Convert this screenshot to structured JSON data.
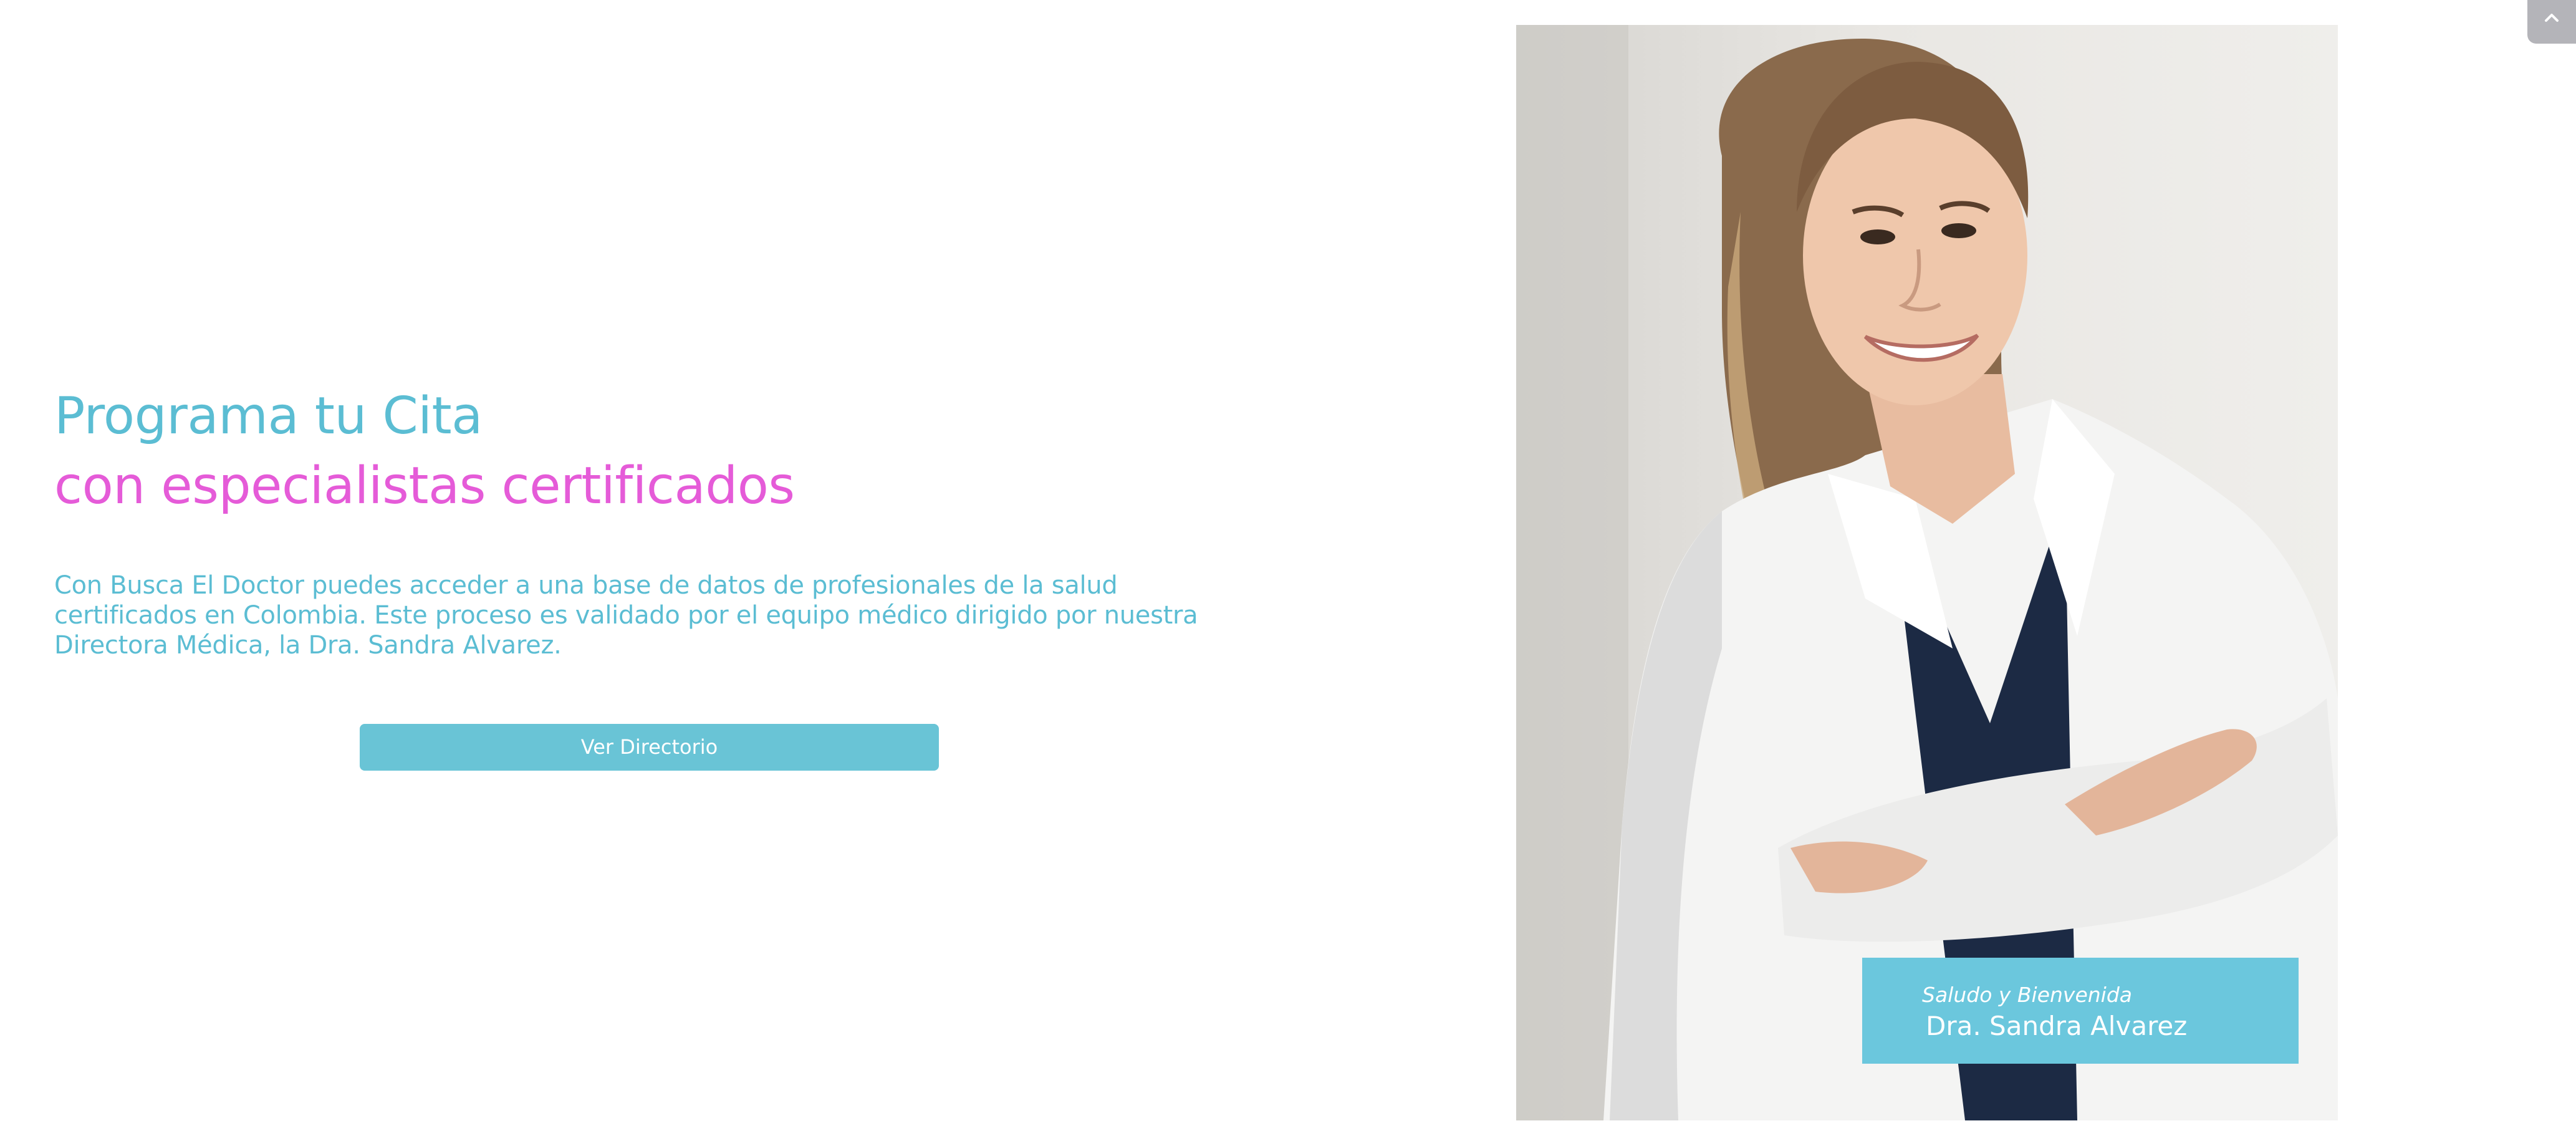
{
  "hero": {
    "headline_line1": "Programa tu Cita",
    "headline_line2": "con especialistas certificados",
    "intro": "Con Busca El Doctor puedes acceder a una base de datos de profesionales de la salud certificados en Colombia. Este proceso es validado por el equipo médico dirigido por nuestra Directora Médica, la Dra. Sandra Alvarez.",
    "cta_label": "Ver Directorio"
  },
  "photo_caption": {
    "greeting": "Saludo y Bienvenida",
    "name": "Dra. Sandra Alvarez"
  },
  "scroll_top": {
    "icon": "chevron-up-icon"
  },
  "colors": {
    "accent_blue": "#5bbdd3",
    "accent_pink": "#e55bd8",
    "button_blue": "#69c4d6",
    "caption_blue": "#6bc7dd",
    "scroll_top_grey": "#b4b4b9"
  }
}
